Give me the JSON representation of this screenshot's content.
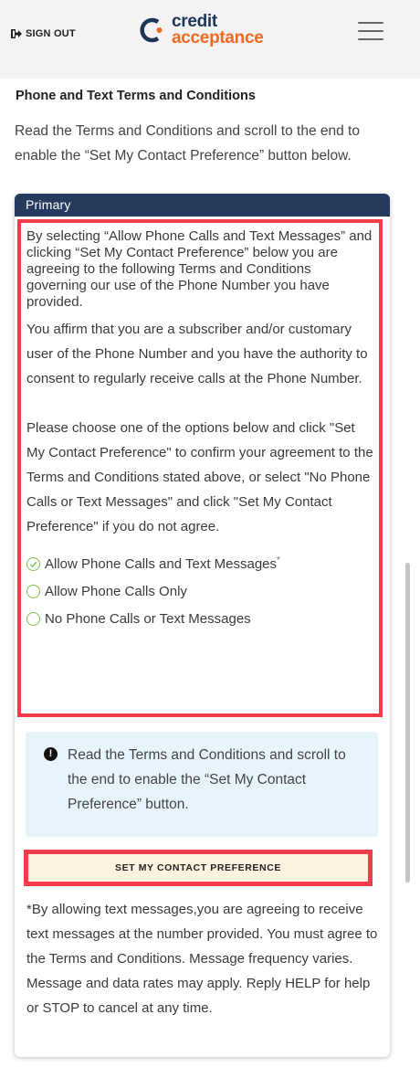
{
  "header": {
    "signout_label": "SIGN OUT",
    "logo_line1": "credit",
    "logo_line2": "acceptance",
    "menu_icon": "hamburger-menu-icon"
  },
  "main": {
    "section_title": "Phone and Text Terms and Conditions",
    "instructions": "Read the Terms and Conditions and scroll to the end to enable the “Set My Contact Preference” button below."
  },
  "card": {
    "header_label": "Primary",
    "terms": {
      "para1": "By selecting “Allow Phone Calls and Text Messages” and clicking “Set My Contact Preference” below you are agreeing to the following Terms and Conditions governing our use of the Phone Number you have provided.",
      "para2": "You affirm that you are a subscriber and/or customary user of the Phone Number and you have the authority to consent to regularly receive calls at the Phone Number.",
      "para3": "Please choose one of the options below and click \"Set My Contact Preference\" to confirm your agreement to the Terms and Conditions stated above, or select \"No Phone Calls or Text Messages\" and click \"Set My Contact Preference\" if you do not agree."
    },
    "options": [
      {
        "label": "Allow Phone Calls and Text Messages",
        "asterisk": "*",
        "selected": true
      },
      {
        "label": "Allow Phone Calls Only",
        "selected": false
      },
      {
        "label": "No Phone Calls or Text Messages",
        "selected": false
      }
    ],
    "notice_icon": "info-icon",
    "notice_text": "Read the Terms and Conditions and scroll to the end to enable the “Set My Contact Preference” button.",
    "button_label": "SET MY CONTACT PREFERENCE",
    "disclaimer": "*By allowing text messages,you are agreeing to receive text messages at the number provided. You must agree to the Terms and Conditions. Message frequency varies. Message and data rates may apply. Reply HELP for help or STOP to cancel at any time."
  },
  "colors": {
    "brand_navy": "#253b5e",
    "brand_orange": "#ef6a1f",
    "highlight_red": "#f23c4a",
    "radio_green": "#7cc24a",
    "notice_bg": "#e8f4fb",
    "button_bg": "#fdf1df"
  }
}
